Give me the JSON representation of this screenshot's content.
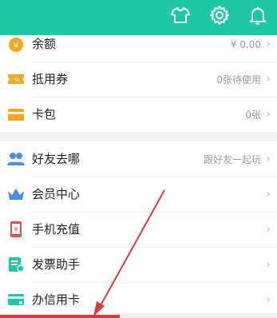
{
  "header": {
    "icons": [
      "shirt-icon",
      "gear-icon",
      "bell-icon"
    ],
    "color": "#1dc8a6"
  },
  "group1": [
    {
      "label": "余额",
      "value": "¥ 0.00",
      "icon": "money-bag-icon",
      "color": "#f5a623"
    },
    {
      "label": "抵用券",
      "value": "0张待使用",
      "icon": "coupon-icon",
      "color": "#f5a623"
    },
    {
      "label": "卡包",
      "value": "0张",
      "icon": "card-wallet-icon",
      "color": "#f5a623"
    }
  ],
  "group2": [
    {
      "label": "好友去哪",
      "value": "跟好友一起玩",
      "icon": "friends-icon",
      "color": "#4a90e2"
    },
    {
      "label": "会员中心",
      "value": "",
      "icon": "crown-icon",
      "color": "#4a90e2"
    },
    {
      "label": "手机充值",
      "value": "",
      "icon": "phone-topup-icon",
      "color": "#e94b4b"
    },
    {
      "label": "发票助手",
      "value": "",
      "icon": "invoice-icon",
      "color": "#1dc8a6"
    },
    {
      "label": "办信用卡",
      "value": "",
      "icon": "credit-card-icon",
      "color": "#1dc8a6"
    }
  ],
  "chevron": "›",
  "annotation": {
    "arrow_color": "#d93a3a"
  }
}
